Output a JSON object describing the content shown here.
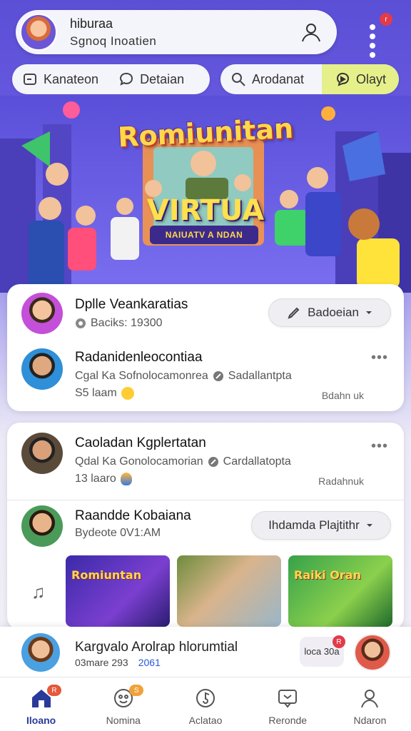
{
  "header": {
    "profile_name": "hiburaa",
    "profile_sub": "Sgnoq Inoatien",
    "notification_count": "r"
  },
  "tabs": {
    "left": [
      {
        "label": "Kanateon",
        "icon": "note-icon"
      },
      {
        "label": "Detaian",
        "icon": "chat-icon"
      }
    ],
    "right": [
      {
        "label": "Arodanat",
        "icon": "search-icon"
      },
      {
        "label": "Olayt",
        "icon": "play-chat-icon",
        "active": true
      }
    ]
  },
  "banner": {
    "title": "Romiunitan",
    "subtitle": "VIRTUA",
    "tagline": "NAIUATV A NDAN"
  },
  "card1": {
    "row1": {
      "title": "Dplle Veankaratias",
      "sub": "Baciks: 19300",
      "button": "Badoeian"
    },
    "row2": {
      "title": "Radanidenleocontiaa",
      "sub_a": "Cgal Ka Sofnolocamonrea",
      "sub_b": "Sadallantpta",
      "meta": "S5 laam",
      "side": "Bdahn uk"
    }
  },
  "card2": {
    "row1": {
      "title": "Caoladan Kgplertatan",
      "sub_a": "Qdal Ka Gonolocamorian",
      "sub_b": "Cardallatopta",
      "meta": "13 laaro",
      "side": "Radahnuk"
    },
    "row2": {
      "title": "Raandde Kobaiana",
      "sub": "Bydeote 0V1:AM",
      "button": "Ihdamda Plajtithr"
    },
    "thumbs": [
      {
        "label": "Romiuntan"
      },
      {
        "label": ""
      },
      {
        "label": "Raiki Oran"
      }
    ]
  },
  "now_playing": {
    "title": "Kargvalo Arolrap hlorumtial",
    "meta_a": "03mare 293",
    "meta_b": "2061",
    "chip": "loca 30a",
    "chip_badge": "R"
  },
  "nav": [
    {
      "label": "Iloano",
      "icon": "home-icon",
      "active": true,
      "badge": "R"
    },
    {
      "label": "Nomina",
      "icon": "community-icon",
      "badge": "S"
    },
    {
      "label": "Aclatao",
      "icon": "music-icon"
    },
    {
      "label": "Reronde",
      "icon": "chat-square-icon"
    },
    {
      "label": "Ndaron",
      "icon": "profile-icon"
    }
  ],
  "colors": {
    "accent": "#6d5fe6",
    "tab_active": "#e5f08a",
    "badge": "#e23b4a",
    "nav_active": "#2a3a9a"
  }
}
